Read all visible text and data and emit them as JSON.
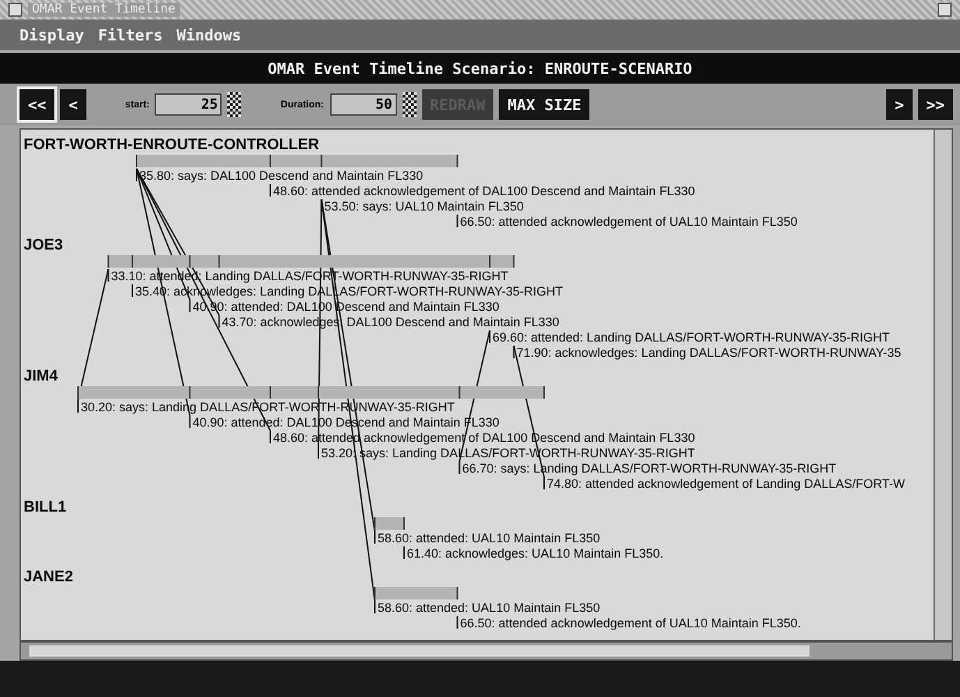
{
  "window": {
    "title": "OMAR Event Timeline"
  },
  "menu": [
    "Display",
    "Filters",
    "Windows"
  ],
  "header": "OMAR Event Timeline Scenario: ENROUTE-SCENARIO",
  "toolbar": {
    "nav_left": [
      "<<",
      "<"
    ],
    "start": {
      "label": "start:",
      "value": "25"
    },
    "duration": {
      "label": "Duration:",
      "value": "50"
    },
    "actions": [
      {
        "label": "REDRAW",
        "disabled": true
      },
      {
        "label": "MAX SIZE",
        "disabled": false
      }
    ],
    "nav_right": [
      ">",
      ">>"
    ]
  },
  "rows": [
    {
      "name": "FORT-WORTH-ENROUTE-CONTROLLER",
      "events": [
        {
          "label": "35.80: says: DAL100 Descend and Maintain FL330"
        },
        {
          "label": "48.60: attended acknowledgement of DAL100 Descend and Maintain FL330"
        },
        {
          "label": "53.50: says: UAL10 Maintain FL350"
        },
        {
          "label": "66.50: attended acknowledgement of UAL10 Maintain FL350"
        }
      ]
    },
    {
      "name": "JOE3",
      "events": [
        {
          "label": "33.10: attended: Landing DALLAS/FORT-WORTH-RUNWAY-35-RIGHT"
        },
        {
          "label": "35.40: acknowledges: Landing DALLAS/FORT-WORTH-RUNWAY-35-RIGHT"
        },
        {
          "label": "40.90: attended: DAL100 Descend and Maintain FL330"
        },
        {
          "label": "43.70: acknowledges: DAL100 Descend and Maintain FL330"
        },
        {
          "label": "69.60: attended: Landing DALLAS/FORT-WORTH-RUNWAY-35-RIGHT"
        },
        {
          "label": "71.90: acknowledges: Landing DALLAS/FORT-WORTH-RUNWAY-35"
        }
      ]
    },
    {
      "name": "JIM4",
      "events": [
        {
          "label": "30.20: says: Landing DALLAS/FORT-WORTH-RUNWAY-35-RIGHT"
        },
        {
          "label": "40.90: attended: DAL100 Descend and Maintain FL330"
        },
        {
          "label": "48.60: attended acknowledgement of DAL100 Descend and Maintain FL330"
        },
        {
          "label": "53.20: says: Landing DALLAS/FORT-WORTH-RUNWAY-35-RIGHT"
        },
        {
          "label": "66.70: says: Landing DALLAS/FORT-WORTH-RUNWAY-35-RIGHT"
        },
        {
          "label": "74.80: attended acknowledgement of Landing DALLAS/FORT-W"
        }
      ]
    },
    {
      "name": "BILL1",
      "events": [
        {
          "label": "58.60: attended: UAL10 Maintain FL350"
        },
        {
          "label": "61.40: acknowledges: UAL10 Maintain FL350."
        }
      ]
    },
    {
      "name": "JANE2",
      "events": [
        {
          "label": "58.60: attended: UAL10 Maintain FL350"
        },
        {
          "label": "66.50: attended acknowledgement of UAL10 Maintain FL350."
        }
      ]
    }
  ]
}
